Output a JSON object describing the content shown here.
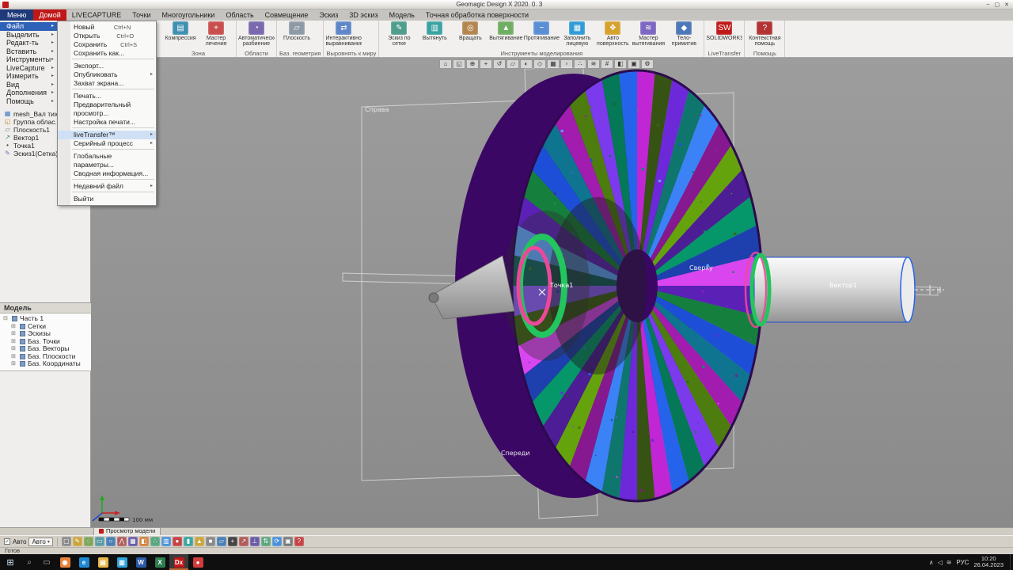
{
  "title_bar": {
    "title": "Geomagic Design X 2020. 0. 3",
    "controls": {
      "minimize": "–",
      "maximize": "▢",
      "close": "✕"
    }
  },
  "menubar": {
    "menu_button": "Меню",
    "tabs": [
      {
        "label": "Домой",
        "active": true
      },
      {
        "label": "LIVECAPTURE"
      },
      {
        "label": "Точки"
      },
      {
        "label": "Многоугольники"
      },
      {
        "label": "Область"
      },
      {
        "label": "Совмещение"
      },
      {
        "label": "Эскиз"
      },
      {
        "label": "3D эскиз"
      },
      {
        "label": "Модель"
      },
      {
        "label": "Точная обработка поверхности"
      }
    ]
  },
  "ribbon": {
    "groups": [
      {
        "caption": "Зона",
        "buttons": [
          {
            "label": "Компрессия",
            "glyph": "▤",
            "color": "#3e8fb0"
          },
          {
            "label": "Мастер лечения",
            "glyph": "+",
            "color": "#c94f4f"
          }
        ]
      },
      {
        "caption": "Области",
        "buttons": [
          {
            "label": "Автоматическое разбиение",
            "glyph": "◔",
            "color": "#7b68ae"
          }
        ]
      },
      {
        "caption": "Баз. геометрия",
        "buttons": [
          {
            "label": "Плоскость",
            "glyph": "▱",
            "color": "#8d9aa5"
          }
        ]
      },
      {
        "caption": "Выровнять к миру",
        "buttons": [
          {
            "label": "Интерактивное выравнивание",
            "glyph": "⇄",
            "color": "#5f87c7"
          }
        ]
      },
      {
        "caption": "Инструменты моделирования",
        "buttons": [
          {
            "label": "Эскиз по сетке",
            "glyph": "✎",
            "color": "#4f9d8b"
          },
          {
            "label": "Вытянуть",
            "glyph": "▥",
            "color": "#3aa3a0"
          },
          {
            "label": "Вращать",
            "glyph": "◎",
            "color": "#b3854f"
          },
          {
            "label": "Вытягивание",
            "glyph": "▲",
            "color": "#6fae62"
          },
          {
            "label": "Протягивание",
            "glyph": "~",
            "color": "#5b8fd4"
          },
          {
            "label": "Заполнить лицевую поверхность",
            "glyph": "▦",
            "color": "#2e9bd6"
          },
          {
            "label": "Авто поверхность",
            "glyph": "❖",
            "color": "#d6a22e"
          },
          {
            "label": "Мастер вытягивания по сечениям",
            "glyph": "≋",
            "color": "#7d67c1"
          },
          {
            "label": "Тело-примитив",
            "glyph": "◆",
            "color": "#4d78b8"
          }
        ]
      },
      {
        "caption": "LiveTransfer",
        "buttons": [
          {
            "label": "SOLIDWORKS",
            "glyph": "SW",
            "color": "#c01818"
          }
        ]
      },
      {
        "caption": "Помощь",
        "buttons": [
          {
            "label": "Контекстная помощь",
            "glyph": "?",
            "color": "#b23333"
          }
        ]
      }
    ]
  },
  "sidebar": {
    "menu_items": [
      {
        "label": "Файл",
        "active": true
      },
      {
        "label": "Выделить"
      },
      {
        "label": "Редакт-ть"
      },
      {
        "label": "Вставить"
      },
      {
        "label": "Инструменты"
      },
      {
        "label": "LiveCapture"
      },
      {
        "label": "Измерить"
      },
      {
        "label": "Вид"
      },
      {
        "label": "Дополнения"
      },
      {
        "label": "Помощь"
      }
    ],
    "tree_items": [
      {
        "glyph": "▦",
        "color": "#3a7bbf",
        "label": "mesh_Вал тихо..."
      },
      {
        "glyph": "◱",
        "color": "#c77d2e",
        "label": "Группа облас..."
      },
      {
        "glyph": "▱",
        "color": "#6b6b6b",
        "label": "Плоскость1"
      },
      {
        "glyph": "↗",
        "color": "#2e8b57",
        "label": "Вектор1"
      },
      {
        "glyph": "•",
        "color": "#444444",
        "label": "Точка1"
      },
      {
        "glyph": "✎",
        "color": "#8a5fbf",
        "label": "Эскиз1(Сетка)"
      }
    ]
  },
  "file_menu": {
    "items": [
      {
        "label": "Новый",
        "shortcut": "Ctrl+N"
      },
      {
        "label": "Открыть",
        "shortcut": "Ctrl+O"
      },
      {
        "label": "Сохранить",
        "shortcut": "Ctrl+S"
      },
      {
        "label": "Сохранить как..."
      },
      {
        "separator": true
      },
      {
        "label": "Экспорт..."
      },
      {
        "label": "Опубликовать",
        "submenu": true
      },
      {
        "label": "Захват экрана..."
      },
      {
        "separator": true
      },
      {
        "label": "Печать..."
      },
      {
        "label": "Предварительный просмотр..."
      },
      {
        "label": "Настройка печати..."
      },
      {
        "separator": true
      },
      {
        "label": "liveTransfer™",
        "submenu": true,
        "highlight": true
      },
      {
        "label": "Серийный процесс",
        "submenu": true
      },
      {
        "separator": true
      },
      {
        "label": "Глобальные параметры..."
      },
      {
        "label": "Сводная информация..."
      },
      {
        "separator": true
      },
      {
        "label": "Недавний файл",
        "submenu": true
      },
      {
        "separator": true
      },
      {
        "label": "Выйти"
      }
    ]
  },
  "model_panel": {
    "title": "Модель",
    "root": "Часть 1",
    "items": [
      "Сетки",
      "Эскизы",
      "Баз. Точки",
      "Баз. Векторы",
      "Баз. Плоскости",
      "Баз. Координаты"
    ]
  },
  "viewport": {
    "toolbar_icons": [
      {
        "name": "home-view-icon",
        "glyph": "⌂"
      },
      {
        "name": "zoom-fit-icon",
        "glyph": "◱"
      },
      {
        "name": "zoom-icon",
        "glyph": "⊕"
      },
      {
        "name": "pan-icon",
        "glyph": "+"
      },
      {
        "name": "rotate-icon",
        "glyph": "↺"
      },
      {
        "name": "front-view-icon",
        "glyph": "▱"
      },
      {
        "name": "shade-mode-icon",
        "glyph": "◐"
      },
      {
        "name": "wireframe-icon",
        "glyph": "◇"
      },
      {
        "name": "grid-icon",
        "glyph": "▦"
      },
      {
        "name": "plane-display-icon",
        "glyph": "▫"
      },
      {
        "name": "point-display-icon",
        "glyph": "∴"
      },
      {
        "name": "mesh-display-icon",
        "glyph": "≋"
      },
      {
        "name": "measure-icon",
        "glyph": "#"
      },
      {
        "name": "section-icon",
        "glyph": "◧"
      },
      {
        "name": "camera-icon",
        "glyph": "▣"
      },
      {
        "name": "settings-icon",
        "glyph": "⚙"
      }
    ],
    "labels": {
      "right_plane": "Справа",
      "top_plane": "Сверху",
      "front_plane": "Спереди",
      "point": "Точка1",
      "vector": "Вектор1"
    },
    "scale_label": "100 мм",
    "gear_palette": [
      "#5b21b6",
      "#15803d",
      "#1d4ed8",
      "#0e7490",
      "#a21caf",
      "#4d7c0f",
      "#7c3aed",
      "#047857",
      "#2563eb",
      "#c026d3",
      "#365314",
      "#6d28d9",
      "#0f766e",
      "#3b82f6",
      "#86198f",
      "#65a30d",
      "#4c1d95",
      "#059669",
      "#1e40af",
      "#d946ef",
      "#3f6212",
      "#8b5cf6",
      "#115e59",
      "#60a5fa"
    ]
  },
  "bottom": {
    "view_tab": "Просмотр модели",
    "auto_check_label": "Авто",
    "auto_combo_value": "Авто",
    "status_text": "Готов",
    "toolbar_icons": [
      {
        "name": "select-tool-icon",
        "glyph": "▢",
        "color": "#8a8a8a"
      },
      {
        "name": "paint-select-icon",
        "glyph": "✎",
        "color": "#caa53d"
      },
      {
        "name": "lasso-icon",
        "glyph": "◌",
        "color": "#7fa65a"
      },
      {
        "name": "rect-select-icon",
        "glyph": "▭",
        "color": "#5a9aa6"
      },
      {
        "name": "circle-select-icon",
        "glyph": "○",
        "color": "#4a7fb5"
      },
      {
        "name": "polyline-icon",
        "glyph": "⋀",
        "color": "#b05a5a"
      },
      {
        "name": "mesh-mode-icon",
        "glyph": "▦",
        "color": "#6a5aa6"
      },
      {
        "name": "region-mode-icon",
        "glyph": "◧",
        "color": "#d2823c"
      },
      {
        "name": "point-mode-icon",
        "glyph": "∴",
        "color": "#5aa67f"
      },
      {
        "name": "shell-icon",
        "glyph": "▥",
        "color": "#4a90d9"
      },
      {
        "name": "sphere-icon",
        "glyph": "●",
        "color": "#c44444"
      },
      {
        "name": "cylinder-icon",
        "glyph": "▮",
        "color": "#3aa3a0"
      },
      {
        "name": "cone-icon",
        "glyph": "▲",
        "color": "#caa53d"
      },
      {
        "name": "box-icon",
        "glyph": "■",
        "color": "#888888"
      },
      {
        "name": "plane-icon",
        "glyph": "▱",
        "color": "#4a7fb5"
      },
      {
        "name": "axis-icon",
        "glyph": "+",
        "color": "#444444"
      },
      {
        "name": "vector-icon",
        "glyph": "↗",
        "color": "#b05a5a"
      },
      {
        "name": "normal-icon",
        "glyph": "⊥",
        "color": "#6a5aa6"
      },
      {
        "name": "flip-icon",
        "glyph": "⇅",
        "color": "#5aa67f"
      },
      {
        "name": "sync-icon",
        "glyph": "⟳",
        "color": "#4a90d9"
      },
      {
        "name": "camera-snap-icon",
        "glyph": "▣",
        "color": "#777777"
      },
      {
        "name": "help-cursor-icon",
        "glyph": "?",
        "color": "#c44444"
      }
    ]
  },
  "taskbar": {
    "apps": [
      {
        "name": "firefox",
        "glyph": "◉",
        "color": "#e8833a"
      },
      {
        "name": "edge",
        "glyph": "e",
        "color": "#1e88d2"
      },
      {
        "name": "explorer",
        "glyph": "▤",
        "color": "#e8b84a"
      },
      {
        "name": "store",
        "glyph": "▥",
        "color": "#2ea3d8"
      },
      {
        "name": "word",
        "glyph": "W",
        "color": "#2b5aa6"
      },
      {
        "name": "excel",
        "glyph": "X",
        "color": "#2e7d4f"
      },
      {
        "name": "designx",
        "glyph": "Dx",
        "color": "#c01818",
        "active": true
      },
      {
        "name": "recorder",
        "glyph": "●",
        "color": "#d23c3c"
      }
    ],
    "tray_icons": [
      {
        "name": "tray-expand-icon",
        "glyph": "∧"
      },
      {
        "name": "volume-icon",
        "glyph": "◁"
      },
      {
        "name": "network-icon",
        "glyph": "≋"
      }
    ],
    "lang": "РУС",
    "time": "10:20",
    "date": "26.04.2023"
  }
}
